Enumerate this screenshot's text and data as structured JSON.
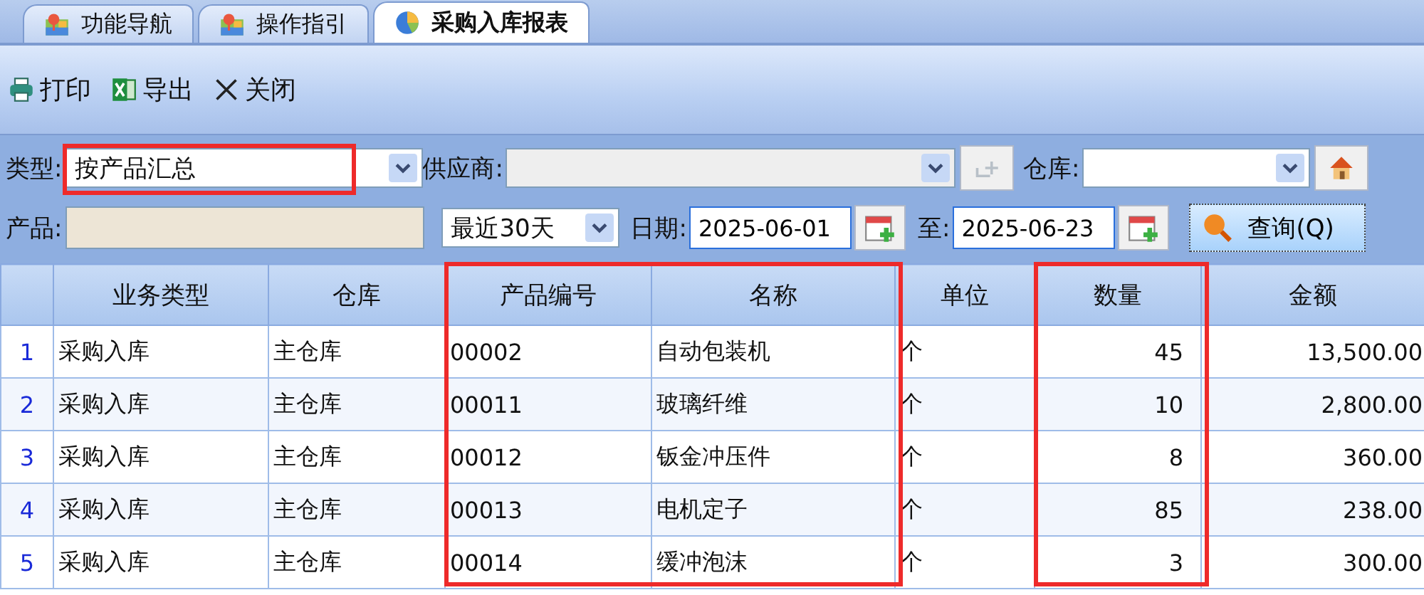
{
  "tabs": [
    {
      "label": "功能导航",
      "selected": false
    },
    {
      "label": "操作指引",
      "selected": false
    },
    {
      "label": "采购入库报表",
      "selected": true
    }
  ],
  "toolbar": [
    "打印",
    "导出",
    "关闭"
  ],
  "filters": {
    "type": {
      "label": "类型:",
      "value": "按产品汇总",
      "highlighted": true
    },
    "supplier": {
      "label": "供应商:",
      "disabled": true
    },
    "warehouse": {
      "label": "仓库:"
    },
    "product": {
      "label": "产品:"
    },
    "range": {
      "value": "最近30天"
    },
    "date_from": {
      "label": "日期:",
      "value": "2025-06-01"
    },
    "date_to": {
      "label": "至:",
      "value": "2025-06-23"
    },
    "query_button": "查询(Q)"
  },
  "table": {
    "columns": [
      {
        "highlighted": false
      },
      {
        "label": "业务类型",
        "highlighted": false
      },
      {
        "label": "仓库",
        "highlighted": false
      },
      {
        "label": "产品编号",
        "highlighted": true
      },
      {
        "label": "名称",
        "highlighted": true
      },
      {
        "label": "单位",
        "highlighted": false
      },
      {
        "label": "数量",
        "highlighted": true
      },
      {
        "label": "金额",
        "highlighted": false
      }
    ],
    "rows": [
      [
        "1",
        "采购入库",
        "主仓库",
        "00002",
        "自动包装机",
        "个",
        "45",
        "13,500.00"
      ],
      [
        "2",
        "采购入库",
        "主仓库",
        "00011",
        "玻璃纤维",
        "个",
        "10",
        "2,800.00"
      ],
      [
        "3",
        "采购入库",
        "主仓库",
        "00012",
        "钣金冲压件",
        "个",
        "8",
        "360.00"
      ],
      [
        "4",
        "采购入库",
        "主仓库",
        "00013",
        "电机定子",
        "个",
        "85",
        "238.00"
      ],
      [
        "5",
        "采购入库",
        "主仓库",
        "00014",
        "缓冲泡沫",
        "个",
        "3",
        "300.00"
      ]
    ]
  }
}
